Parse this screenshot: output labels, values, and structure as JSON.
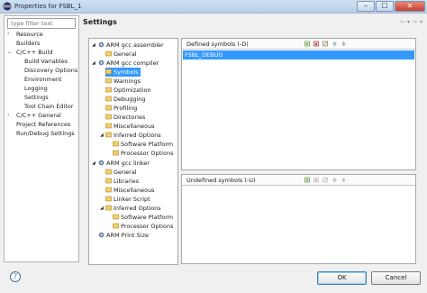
{
  "window": {
    "title": "Properties for FSBL_1",
    "controls": [
      "–",
      "☐",
      "✕"
    ]
  },
  "filter": {
    "placeholder": "type filter text"
  },
  "nav": {
    "items": [
      {
        "label": "Resource",
        "arrow": "›"
      },
      {
        "label": "Builders",
        "arrow": ""
      },
      {
        "label": "C/C++ Build",
        "arrow": "⌄"
      },
      {
        "label": "Build Variables",
        "arrow": ""
      },
      {
        "label": "Discovery Options",
        "arrow": ""
      },
      {
        "label": "Environment",
        "arrow": ""
      },
      {
        "label": "Logging",
        "arrow": ""
      },
      {
        "label": "Settings",
        "arrow": ""
      },
      {
        "label": "Tool Chain Editor",
        "arrow": ""
      },
      {
        "label": "C/C++ General",
        "arrow": "›"
      },
      {
        "label": "Project References",
        "arrow": ""
      },
      {
        "label": "Run/Debug Settings",
        "arrow": ""
      }
    ]
  },
  "settings": {
    "title": "Settings",
    "nav_arrows": [
      "⇦",
      "▾",
      "⇨",
      "▾"
    ]
  },
  "tree": {
    "items": [
      {
        "label": "ARM gcc assembler",
        "toggle": "◢"
      },
      {
        "label": "General",
        "toggle": ""
      },
      {
        "label": "ARM gcc compiler",
        "toggle": "◢"
      },
      {
        "label": "Symbols",
        "toggle": ""
      },
      {
        "label": "Warnings",
        "toggle": ""
      },
      {
        "label": "Optimization",
        "toggle": ""
      },
      {
        "label": "Debugging",
        "toggle": ""
      },
      {
        "label": "Profiling",
        "toggle": ""
      },
      {
        "label": "Directories",
        "toggle": ""
      },
      {
        "label": "Miscellaneous",
        "toggle": ""
      },
      {
        "label": "Inferred Options",
        "toggle": "◢"
      },
      {
        "label": "Software Platform",
        "toggle": ""
      },
      {
        "label": "Processor Options",
        "toggle": ""
      },
      {
        "label": "ARM gcc linker",
        "toggle": "◢"
      },
      {
        "label": "General",
        "toggle": ""
      },
      {
        "label": "Libraries",
        "toggle": ""
      },
      {
        "label": "Miscellaneous",
        "toggle": ""
      },
      {
        "label": "Linker Script",
        "toggle": ""
      },
      {
        "label": "Inferred Options",
        "toggle": "◢"
      },
      {
        "label": "Software Platform",
        "toggle": ""
      },
      {
        "label": "Processor Options",
        "toggle": ""
      },
      {
        "label": "ARM Print Size",
        "toggle": ""
      }
    ]
  },
  "defined": {
    "label": "Defined symbols (-D)",
    "values": [
      "FSBL_DEBUG"
    ]
  },
  "undefined": {
    "label": "Undefined symbols (-U)"
  },
  "footer": {
    "help": "?",
    "ok": "OK",
    "cancel": "Cancel"
  }
}
